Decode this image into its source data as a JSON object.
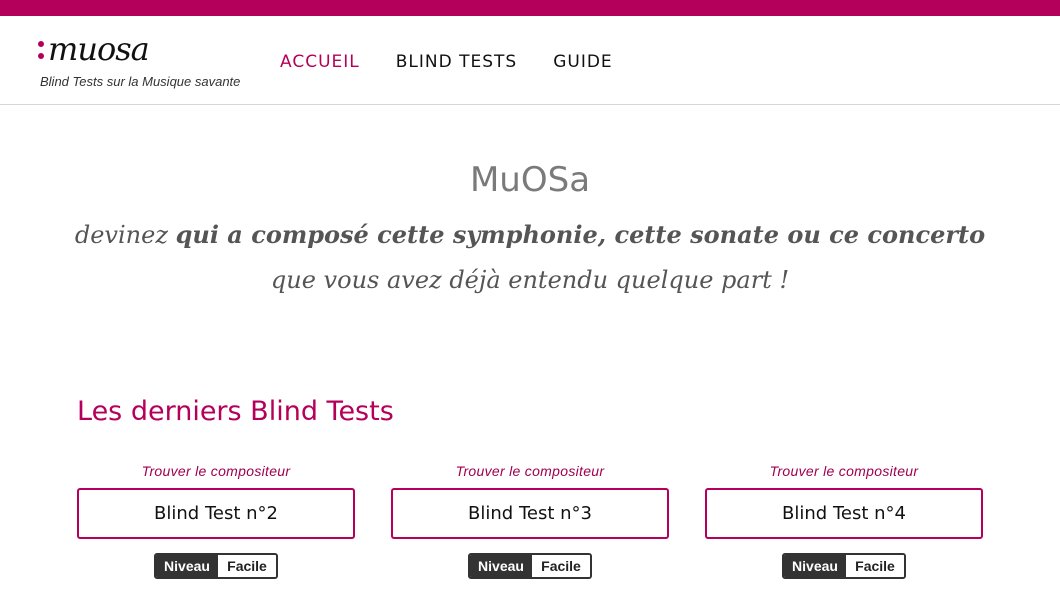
{
  "brand": {
    "logo_text": "muosa",
    "tagline": "Blind Tests sur la Musique savante",
    "accent_color": "#b5005b"
  },
  "nav": {
    "items": [
      {
        "label": "ACCUEIL",
        "active": true
      },
      {
        "label": "BLIND TESTS",
        "active": false
      },
      {
        "label": "GUIDE",
        "active": false
      }
    ]
  },
  "hero": {
    "title": "MuOSa",
    "line1_prefix": "devinez ",
    "line1_bold": "qui a composé cette symphonie, cette sonate ou ce concerto",
    "line2": "que vous avez déjà entendu quelque part !"
  },
  "latest": {
    "section_title": "Les derniers Blind Tests",
    "cards": [
      {
        "label": "Trouver le compositeur",
        "title": "Blind Test n°2",
        "level_key": "Niveau",
        "level_value": "Facile"
      },
      {
        "label": "Trouver le compositeur",
        "title": "Blind Test n°3",
        "level_key": "Niveau",
        "level_value": "Facile"
      },
      {
        "label": "Trouver le compositeur",
        "title": "Blind Test n°4",
        "level_key": "Niveau",
        "level_value": "Facile"
      }
    ]
  }
}
